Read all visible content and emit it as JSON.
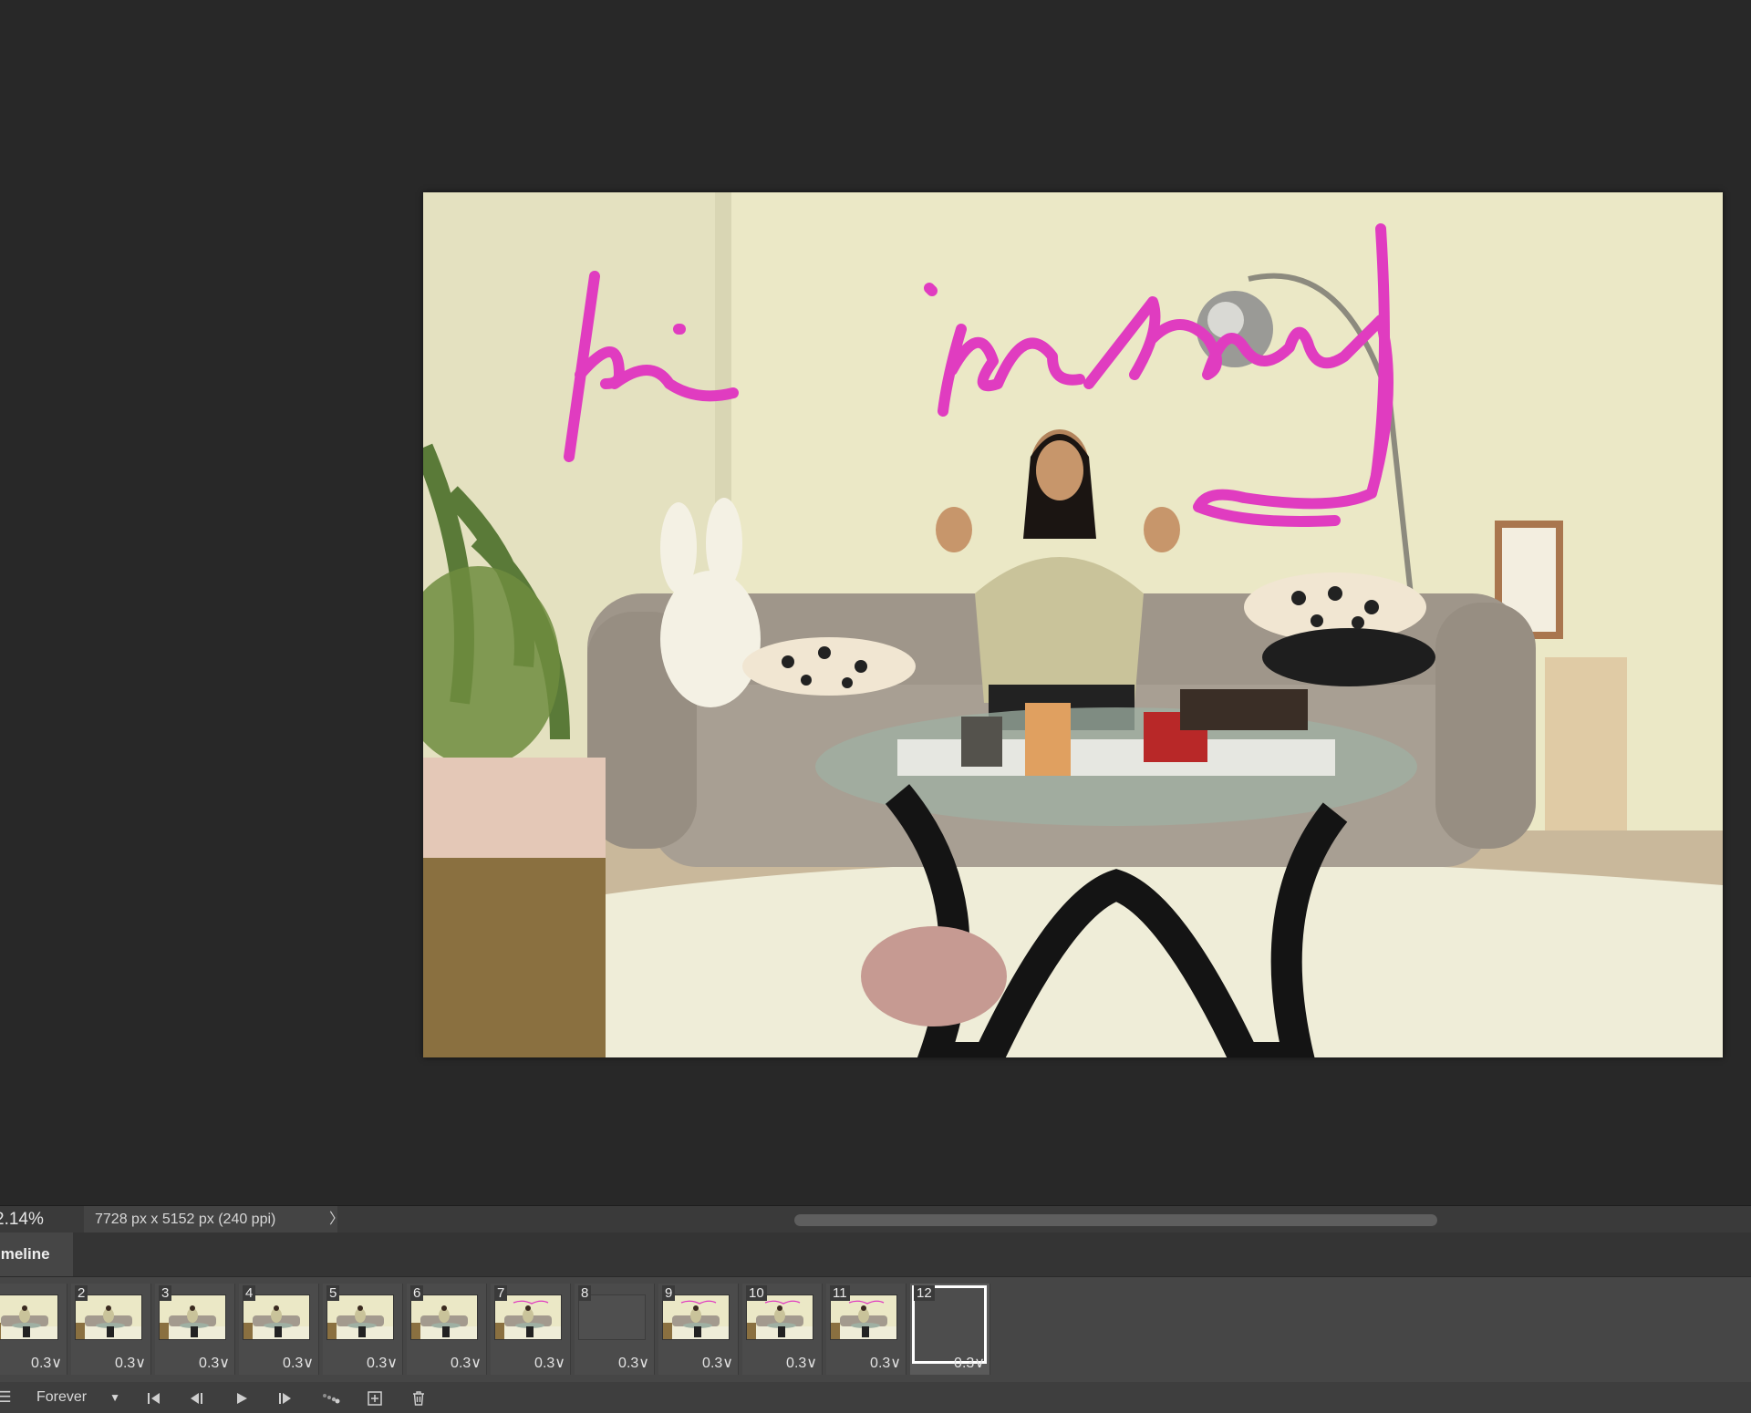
{
  "canvas": {
    "handwriting_overlay": "hi im mary"
  },
  "status_bar": {
    "zoom": "2.14%",
    "document_info": "7728 px x 5152 px (240 ppi)",
    "more_arrow": "〉"
  },
  "timeline": {
    "tab_label": "imeline",
    "loop_option": "Forever",
    "frames": [
      {
        "number": "",
        "delay": "0.3∨",
        "content": "photo"
      },
      {
        "number": "2",
        "delay": "0.3∨",
        "content": "photo"
      },
      {
        "number": "3",
        "delay": "0.3∨",
        "content": "photo"
      },
      {
        "number": "4",
        "delay": "0.3∨",
        "content": "photo"
      },
      {
        "number": "5",
        "delay": "0.3∨",
        "content": "photo"
      },
      {
        "number": "6",
        "delay": "0.3∨",
        "content": "photo"
      },
      {
        "number": "7",
        "delay": "0.3∨",
        "content": "photo"
      },
      {
        "number": "8",
        "delay": "0.3∨",
        "content": "empty"
      },
      {
        "number": "9",
        "delay": "0.3∨",
        "content": "photo"
      },
      {
        "number": "10",
        "delay": "0.3∨",
        "content": "photo"
      },
      {
        "number": "11",
        "delay": "0.3∨",
        "content": "photo"
      },
      {
        "number": "12",
        "delay": "0.3∨",
        "content": "selected-empty"
      }
    ]
  },
  "colors": {
    "canvas_bg": "#282828",
    "panel_bg": "#464646",
    "ink_magenta": "#e03cc0",
    "wall": "#ece9c7"
  }
}
